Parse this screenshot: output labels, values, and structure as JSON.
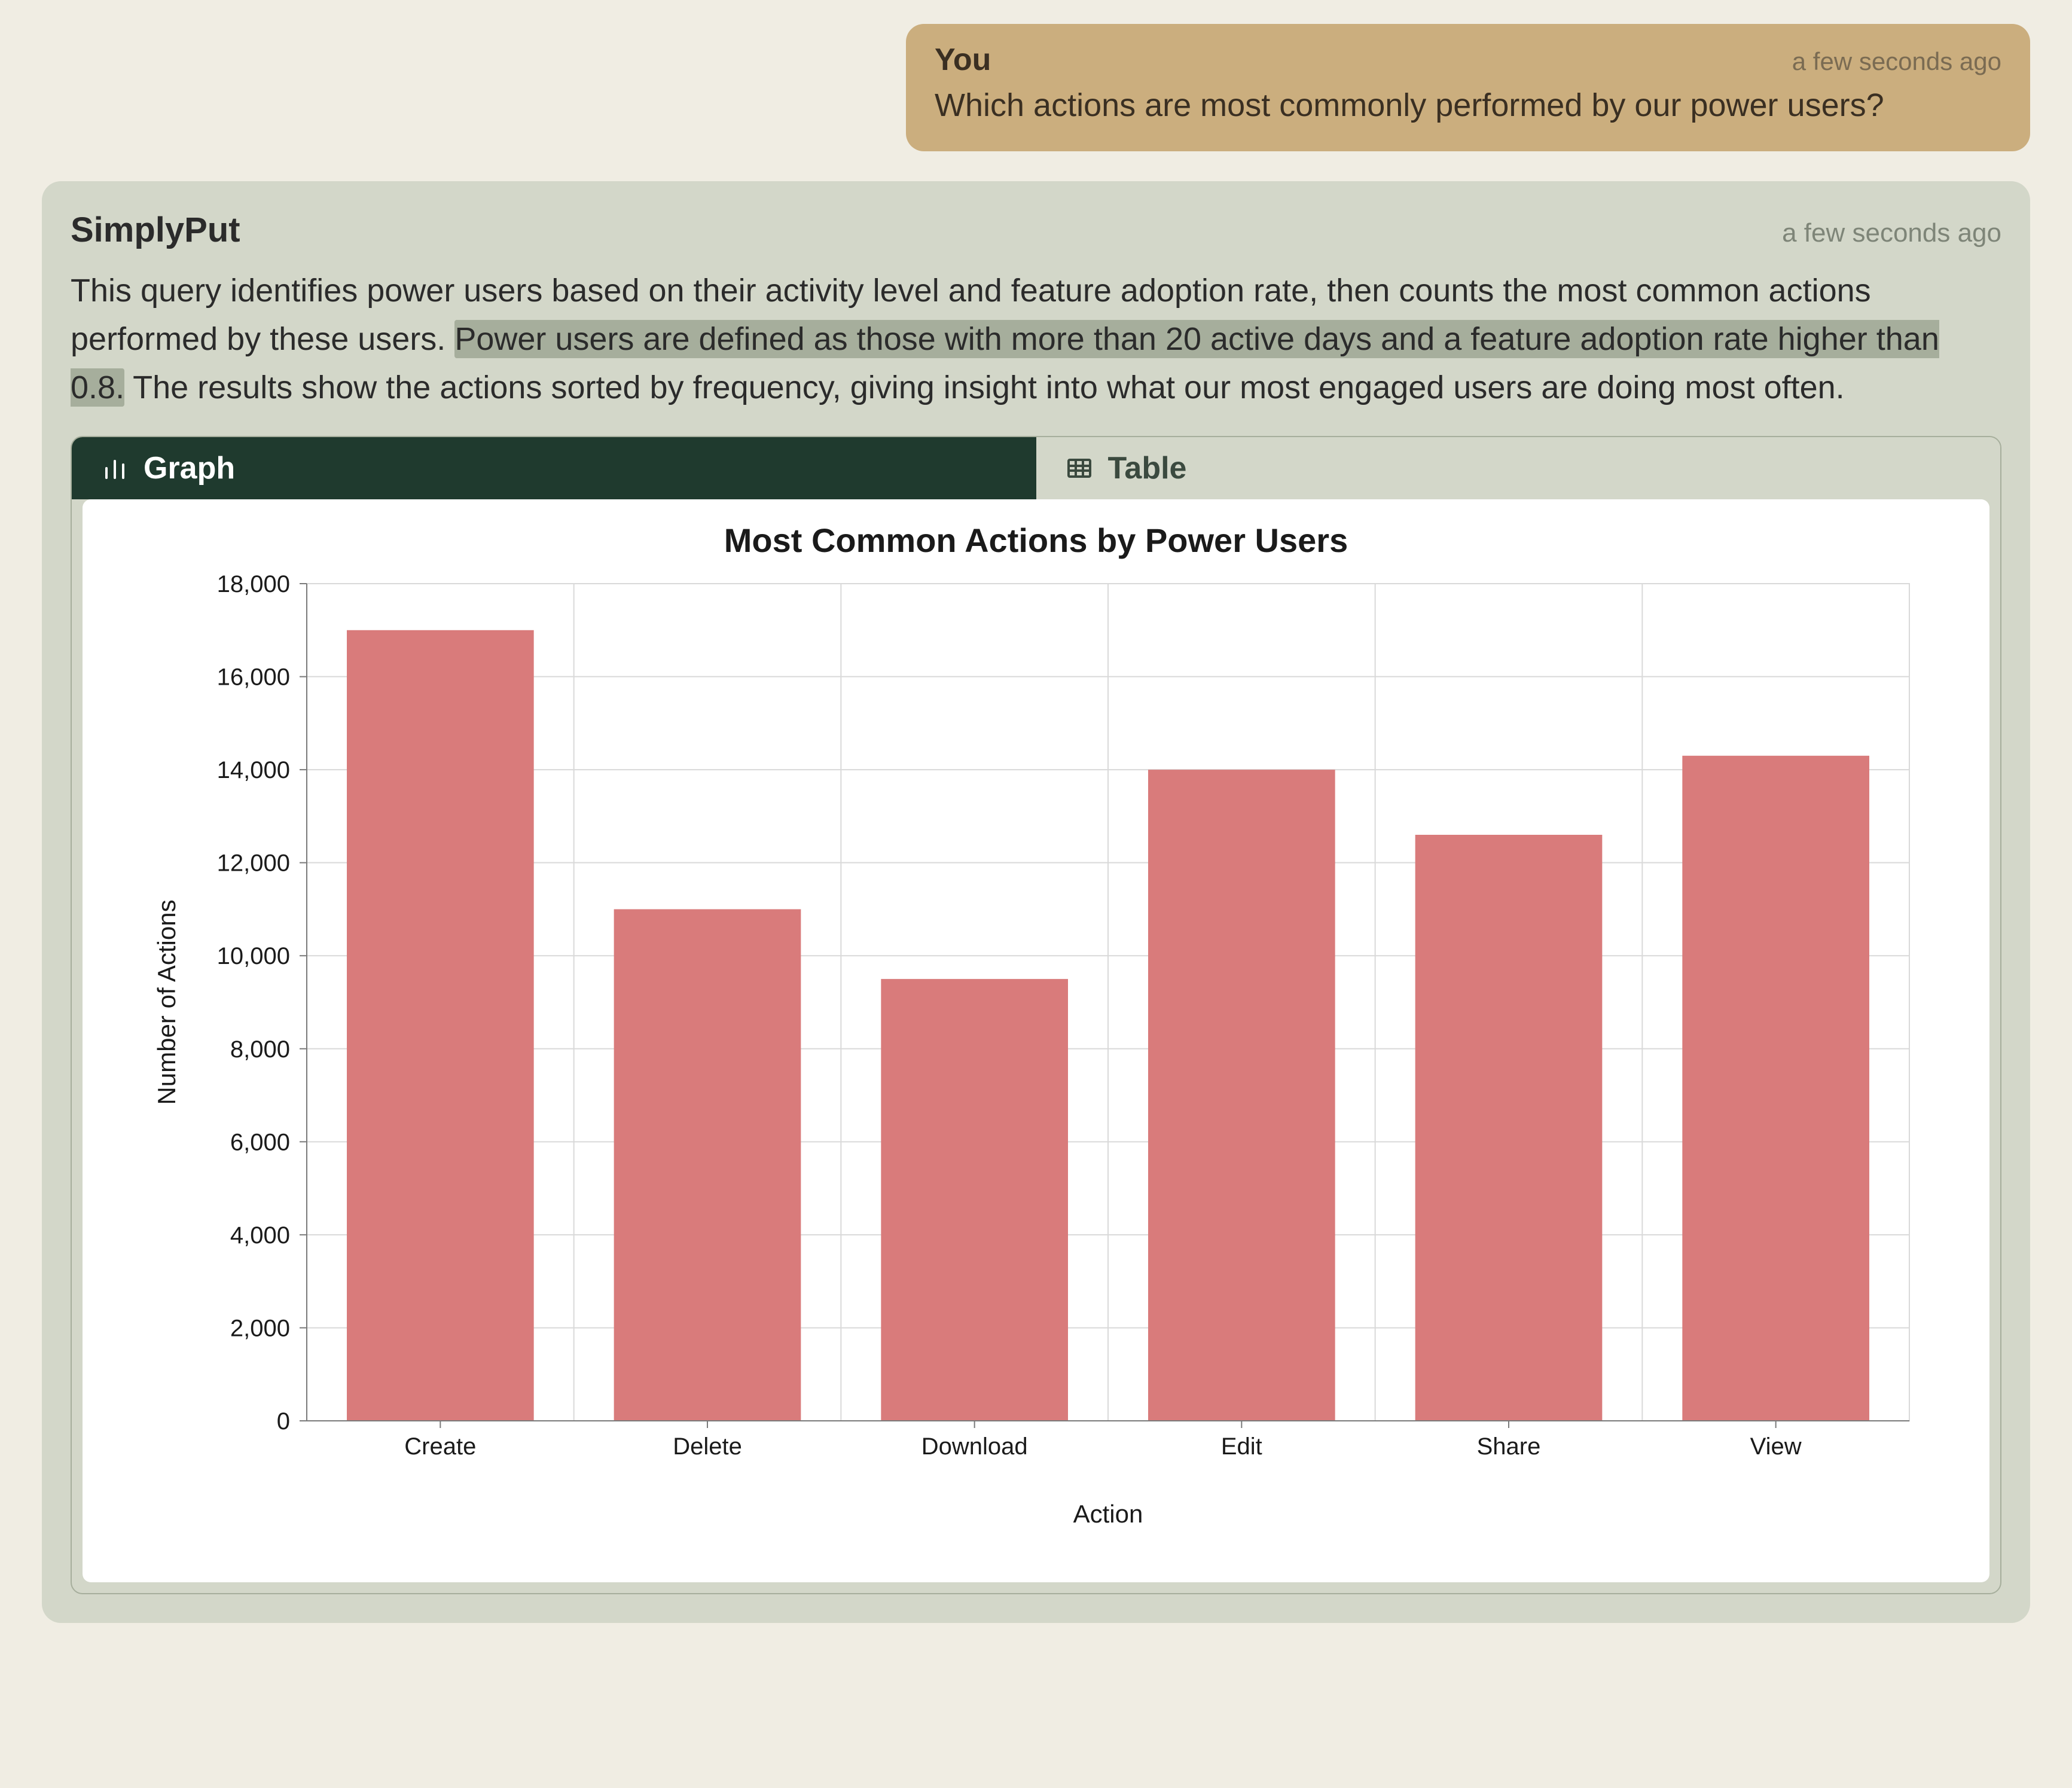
{
  "user_message": {
    "author": "You",
    "timestamp": "a few seconds ago",
    "text": "Which actions are most commonly performed by our power users?"
  },
  "assistant_message": {
    "author": "SimplyPut",
    "timestamp": "a few seconds ago",
    "text_pre": "This query identifies power users based on their activity level and feature adoption rate, then counts the most common actions performed by these users. ",
    "text_highlight": "Power users are defined as those with more than 20 active days and a feature adoption rate higher than 0.8.",
    "text_post": " The results show the actions sorted by frequency, giving insight into what our most engaged users are doing most often."
  },
  "tabs": {
    "graph": "Graph",
    "table": "Table"
  },
  "chart_data": {
    "type": "bar",
    "title": "Most Common Actions by Power Users",
    "xlabel": "Action",
    "ylabel": "Number of Actions",
    "categories": [
      "Create",
      "Delete",
      "Download",
      "Edit",
      "Share",
      "View"
    ],
    "values": [
      17000,
      11000,
      9500,
      14000,
      12600,
      14300
    ],
    "ylim": [
      0,
      18000
    ],
    "yticks": [
      0,
      2000,
      4000,
      6000,
      8000,
      10000,
      12000,
      14000,
      16000,
      18000
    ],
    "bar_color": "#d97b7b"
  }
}
